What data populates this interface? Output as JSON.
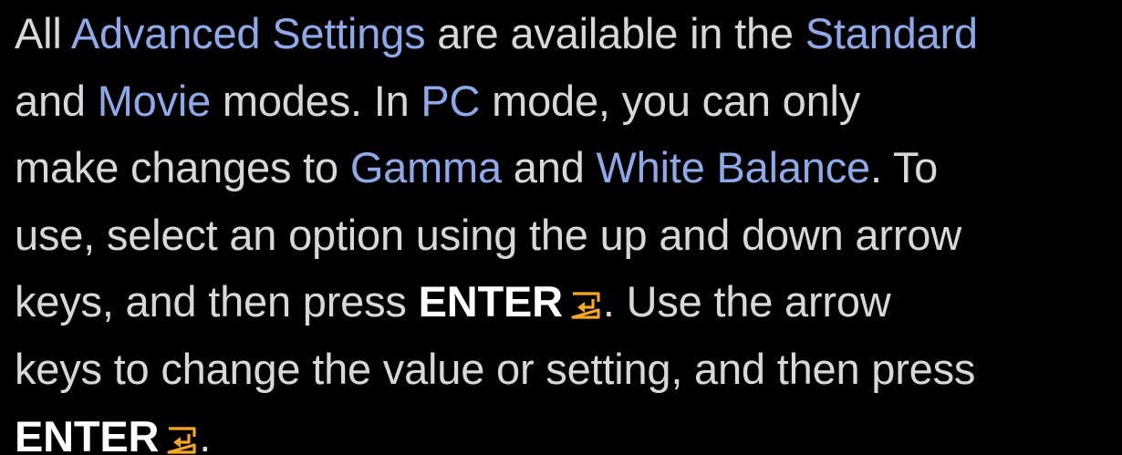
{
  "help_text": {
    "l1_a": "All ",
    "l1_b": "Advanced Settings",
    "l1_c": " are available in the ",
    "l1_d": "Standard",
    "l2_a": "and ",
    "l2_b": "Movie",
    "l2_c": " modes. In ",
    "l2_d": "PC",
    "l2_e": " mode, you can only",
    "l3_a": "make changes to ",
    "l3_b": "Gamma",
    "l3_c": " and ",
    "l3_d": "White Balance",
    "l3_e": ". To",
    "l4_a": "use, select an option using the up and down arrow",
    "l5_a": "keys, and then press ",
    "l5_b": "ENTER",
    "l5_c": ". Use the arrow",
    "l6_a": "keys to change the value or setting, and then press",
    "l7_a": "ENTER",
    "l7_b": "."
  },
  "colors": {
    "background": "#000000",
    "body_text": "#d8d8d8",
    "highlight_text": "#8fa8e8",
    "enter_icon": "#f5a623"
  },
  "icons": {
    "enter": "enter-key-icon"
  }
}
